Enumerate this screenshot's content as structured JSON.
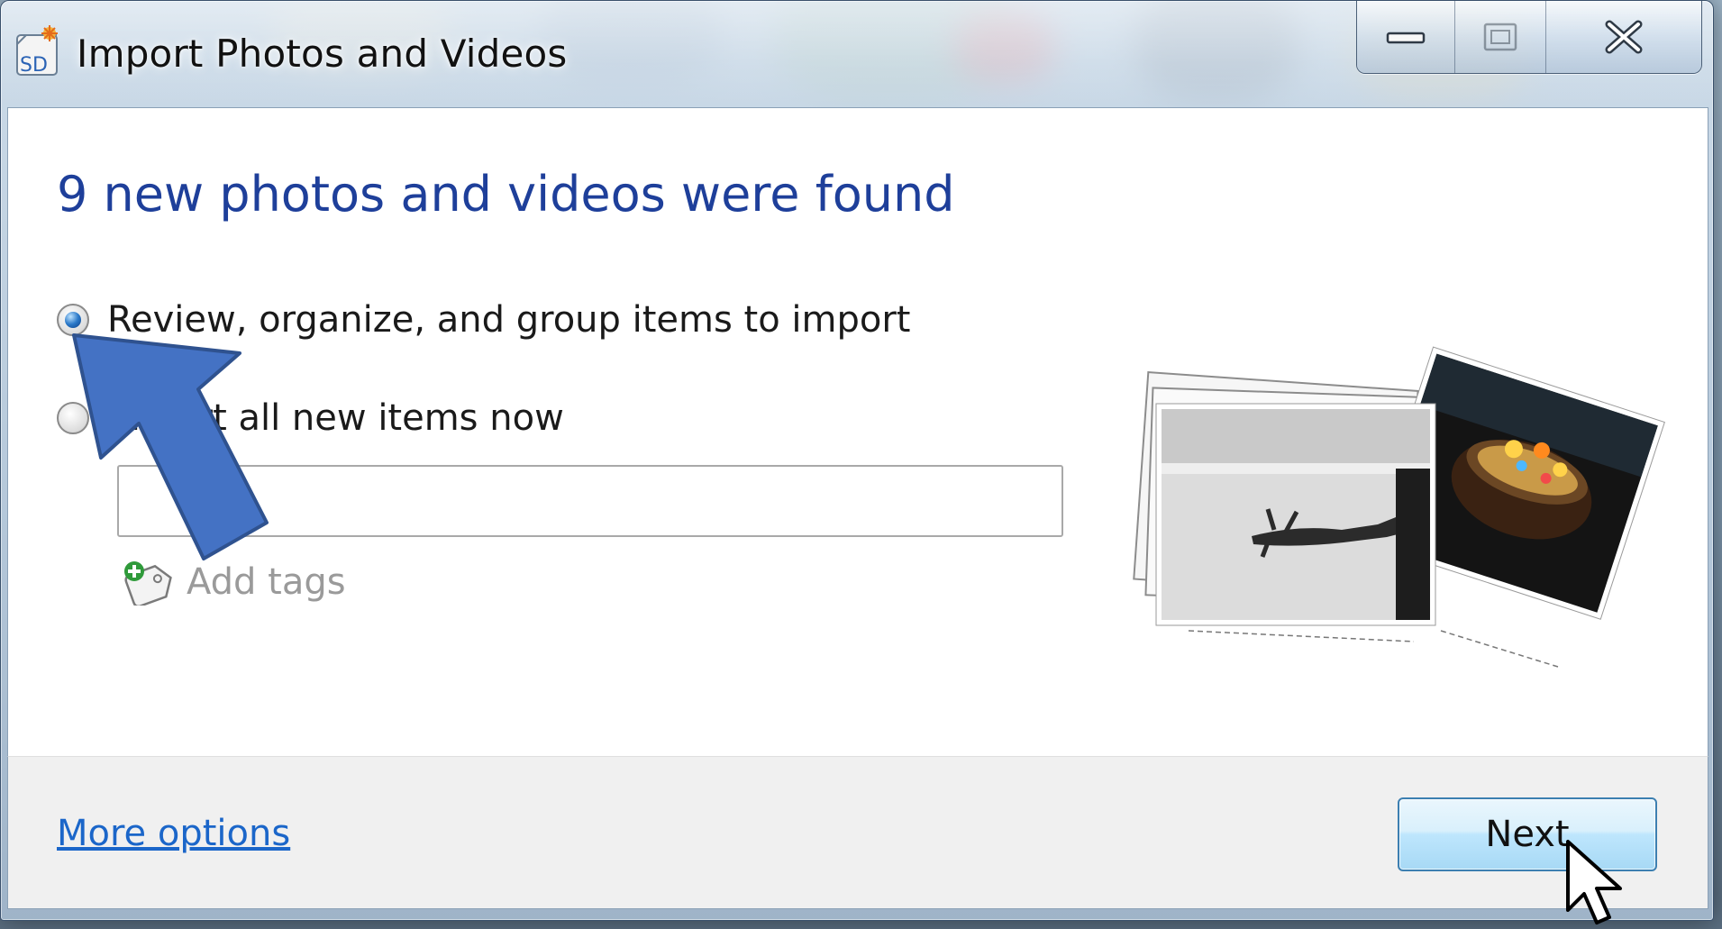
{
  "window": {
    "title": "Import Photos and Videos",
    "app_icon": "sd-card-icon"
  },
  "caption_buttons": [
    "minimize-icon",
    "maximize-icon",
    "close-icon"
  ],
  "main": {
    "heading": "9 new photos and videos were found",
    "options": [
      {
        "label": "Review, organize, and group items to import",
        "selected": true
      },
      {
        "label": "Import all new items now",
        "selected": false
      }
    ],
    "tags_input_value": "",
    "add_tags_label": "Add tags",
    "illustration": "photo-stack-illustration"
  },
  "footer": {
    "more_options_label": "More options",
    "next_label": "Next"
  },
  "annotation": {
    "arrow_icon": "arrow-annotation-icon",
    "arrow_color": "#4472c4"
  },
  "colors": {
    "heading": "#1e3f9a",
    "link": "#1b66c9",
    "disabled_text": "#9a9a9a"
  }
}
